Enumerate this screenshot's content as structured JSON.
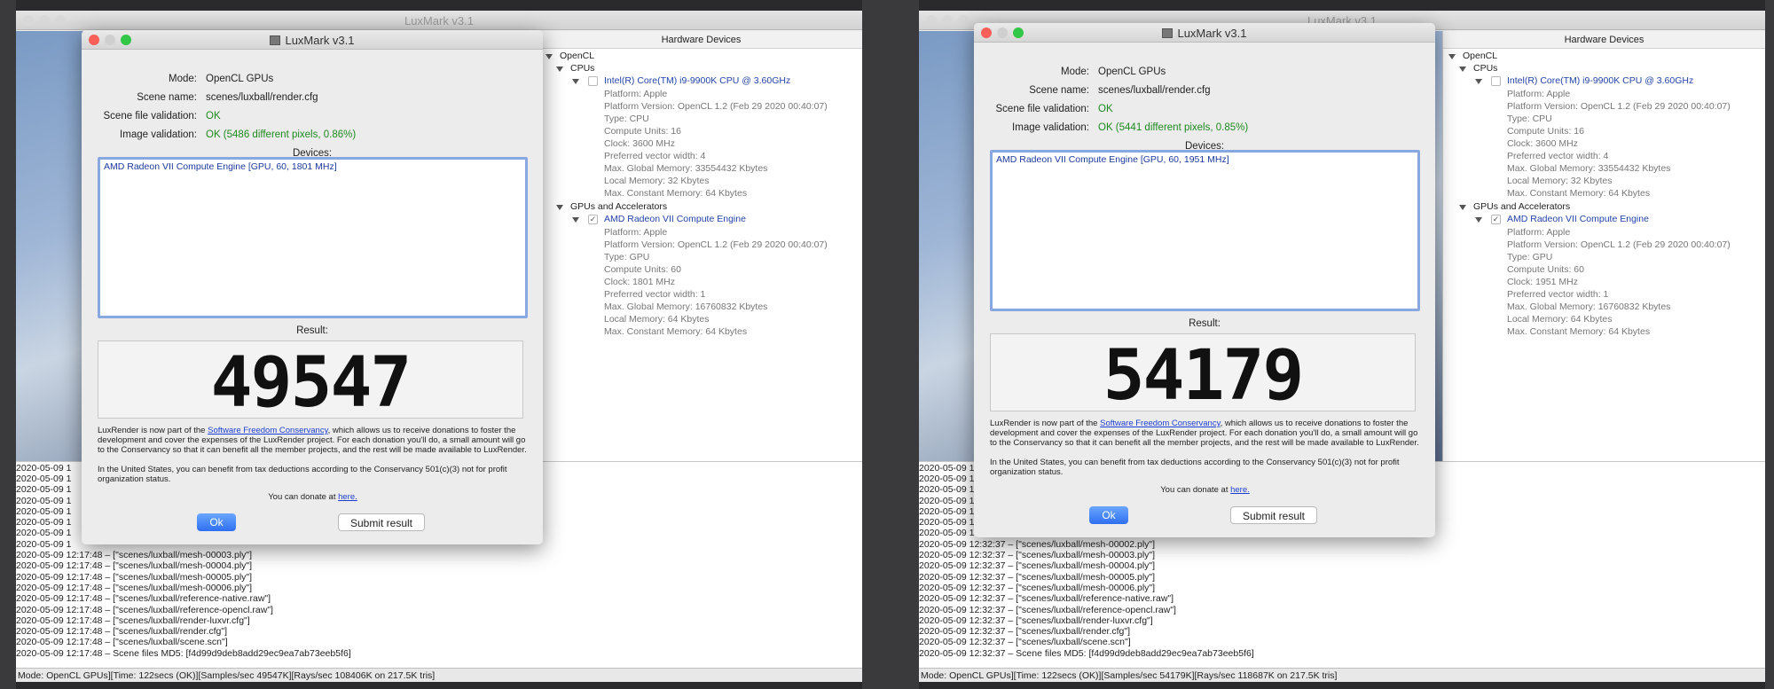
{
  "left": {
    "main_title": "LuxMark v3.1",
    "dialog": {
      "title": "LuxMark v3.1",
      "mode_label": "Mode:",
      "mode": "OpenCL GPUs",
      "scene_label": "Scene name:",
      "scene": "scenes/luxball/render.cfg",
      "sfv_label": "Scene file validation:",
      "sfv": "OK",
      "iv_label": "Image validation:",
      "iv": "OK (5486 different pixels, 0.86%)",
      "devices_label": "Devices:",
      "device": "AMD Radeon VII Compute Engine [GPU, 60, 1801 MHz]",
      "result_label": "Result:",
      "score": "49547",
      "blurb1_pre": "LuxRender is now part of the ",
      "blurb1_link": "Software Freedom Conservancy",
      "blurb1_post": ", which allows us to receive donations to foster the development and cover the expenses of the LuxRender project. For each donation you'll do, a small amount will go to the Conservancy so that it can benefit all the member projects, and the rest will be made available to LuxRender.",
      "blurb2": "In the United States, you can benefit from tax deductions according to the Conservancy 501(c)(3) not for profit organization status.",
      "donate_pre": "You can donate at ",
      "donate_link": "here.",
      "ok": "Ok",
      "submit": "Submit result"
    },
    "hw": {
      "header": "Hardware Devices",
      "opencl": "OpenCL",
      "cpus": "CPUs",
      "cpu_name": "Intel(R) Core(TM) i9-9900K CPU @ 3.60GHz",
      "cpu_props": [
        "Platform: Apple",
        "Platform Version: OpenCL 1.2 (Feb 29 2020 00:40:07)",
        "Type: CPU",
        "Compute Units: 16",
        "Clock: 3600 MHz",
        "Preferred vector width: 4",
        "Max. Global Memory: 33554432 Kbytes",
        "Local Memory: 32 Kbytes",
        "Max. Constant Memory: 64 Kbytes"
      ],
      "gpus": "GPUs and Accelerators",
      "gpu_name": "AMD Radeon VII Compute Engine",
      "gpu_props": [
        "Platform: Apple",
        "Platform Version: OpenCL 1.2 (Feb 29 2020 00:40:07)",
        "Type: GPU",
        "Compute Units: 60",
        "Clock: 1801 MHz",
        "Preferred vector width: 1",
        "Max. Global Memory: 16760832 Kbytes",
        "Local Memory: 64 Kbytes",
        "Max. Constant Memory: 64 Kbytes"
      ]
    },
    "log": [
      "2020-05-09 1",
      "2020-05-09 1",
      "2020-05-09 1",
      "2020-05-09 1",
      "2020-05-09 1",
      "2020-05-09 1",
      "2020-05-09 1",
      "2020-05-09 1",
      "2020-05-09 12:17:48 –   [\"scenes/luxball/mesh-00003.ply\"]",
      "2020-05-09 12:17:48 –   [\"scenes/luxball/mesh-00004.ply\"]",
      "2020-05-09 12:17:48 –   [\"scenes/luxball/mesh-00005.ply\"]",
      "2020-05-09 12:17:48 –   [\"scenes/luxball/mesh-00006.ply\"]",
      "2020-05-09 12:17:48 –   [\"scenes/luxball/reference-native.raw\"]",
      "2020-05-09 12:17:48 –   [\"scenes/luxball/reference-opencl.raw\"]",
      "2020-05-09 12:17:48 –   [\"scenes/luxball/render-luxvr.cfg\"]",
      "2020-05-09 12:17:48 –   [\"scenes/luxball/render.cfg\"]",
      "2020-05-09 12:17:48 –   [\"scenes/luxball/scene.scn\"]",
      "2020-05-09 12:17:48 – Scene files MD5: [f4d99d9deb8add29ec9ea7ab73eeb5f6]"
    ],
    "status": "Mode: OpenCL GPUs][Time: 122secs (OK)][Samples/sec  49547K][Rays/sec  108406K on 217.5K tris]"
  },
  "right": {
    "main_title": "LuxMark v3.1",
    "dialog": {
      "title": "LuxMark v3.1",
      "mode_label": "Mode:",
      "mode": "OpenCL GPUs",
      "scene_label": "Scene name:",
      "scene": "scenes/luxball/render.cfg",
      "sfv_label": "Scene file validation:",
      "sfv": "OK",
      "iv_label": "Image validation:",
      "iv": "OK (5441 different pixels, 0.85%)",
      "devices_label": "Devices:",
      "device": "AMD Radeon VII Compute Engine [GPU, 60, 1951 MHz]",
      "result_label": "Result:",
      "score": "54179",
      "blurb1_pre": "LuxRender is now part of the ",
      "blurb1_link": "Software Freedom Conservancy",
      "blurb1_post": ", which allows us to receive donations to foster the development and cover the expenses of the LuxRender project. For each donation you'll do, a small amount will go to the Conservancy so that it can benefit all the member projects, and the rest will be made available to LuxRender.",
      "blurb2": "In the United States, you can benefit from tax deductions according to the Conservancy 501(c)(3) not for profit organization status.",
      "donate_pre": "You can donate at ",
      "donate_link": "here.",
      "ok": "Ok",
      "submit": "Submit result"
    },
    "hw": {
      "header": "Hardware Devices",
      "opencl": "OpenCL",
      "cpus": "CPUs",
      "cpu_name": "Intel(R) Core(TM) i9-9900K CPU @ 3.60GHz",
      "cpu_props": [
        "Platform: Apple",
        "Platform Version: OpenCL 1.2 (Feb 29 2020 00:40:07)",
        "Type: CPU",
        "Compute Units: 16",
        "Clock: 3600 MHz",
        "Preferred vector width: 4",
        "Max. Global Memory: 33554432 Kbytes",
        "Local Memory: 32 Kbytes",
        "Max. Constant Memory: 64 Kbytes"
      ],
      "gpus": "GPUs and Accelerators",
      "gpu_name": "AMD Radeon VII Compute Engine",
      "gpu_props": [
        "Platform: Apple",
        "Platform Version: OpenCL 1.2 (Feb 29 2020 00:40:07)",
        "Type: GPU",
        "Compute Units: 60",
        "Clock: 1951 MHz",
        "Preferred vector width: 1",
        "Max. Global Memory: 16760832 Kbytes",
        "Local Memory: 64 Kbytes",
        "Max. Constant Memory: 64 Kbytes"
      ]
    },
    "log": [
      "2020-05-09 1",
      "2020-05-09 1",
      "2020-05-09 1",
      "2020-05-09 1",
      "2020-05-09 1",
      "2020-05-09 1",
      "2020-05-09 1",
      "2020-05-09 12:32:37 –   [\"scenes/luxball/mesh-00002.ply\"]",
      "2020-05-09 12:32:37 –   [\"scenes/luxball/mesh-00003.ply\"]",
      "2020-05-09 12:32:37 –   [\"scenes/luxball/mesh-00004.ply\"]",
      "2020-05-09 12:32:37 –   [\"scenes/luxball/mesh-00005.ply\"]",
      "2020-05-09 12:32:37 –   [\"scenes/luxball/mesh-00006.ply\"]",
      "2020-05-09 12:32:37 –   [\"scenes/luxball/reference-native.raw\"]",
      "2020-05-09 12:32:37 –   [\"scenes/luxball/reference-opencl.raw\"]",
      "2020-05-09 12:32:37 –   [\"scenes/luxball/render-luxvr.cfg\"]",
      "2020-05-09 12:32:37 –   [\"scenes/luxball/render.cfg\"]",
      "2020-05-09 12:32:37 –   [\"scenes/luxball/scene.scn\"]",
      "2020-05-09 12:32:37 – Scene files MD5: [f4d99d9deb8add29ec9ea7ab73eeb5f6]"
    ],
    "status": "Mode: OpenCL GPUs][Time: 122secs (OK)][Samples/sec  54179K][Rays/sec  118687K on 217.5K tris]"
  },
  "colors": {
    "ok_green": "#1f8a1f",
    "link_blue": "#1a3fd0",
    "device_blue": "#2344a8",
    "ok_button": "#2e6ff0"
  }
}
